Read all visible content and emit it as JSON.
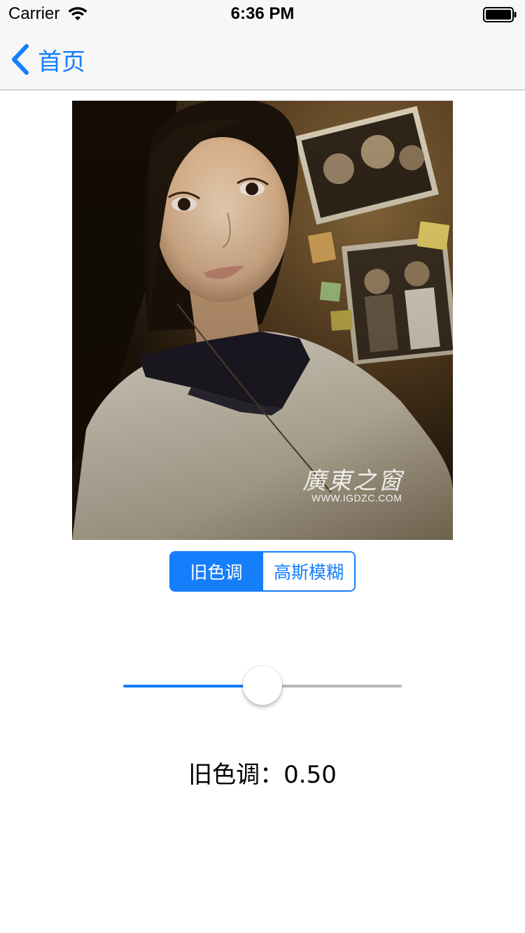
{
  "status_bar": {
    "carrier": "Carrier",
    "time": "6:36 PM",
    "wifi_icon": "wifi-icon",
    "battery_icon": "battery-icon"
  },
  "nav_bar": {
    "back_label": "首页",
    "back_icon": "chevron-left-icon"
  },
  "photo": {
    "watermark_text": "廣東之窗",
    "watermark_url": "WWW.IGDZC.COM"
  },
  "segmented_control": {
    "segments": [
      "旧色调",
      "高斯模糊"
    ],
    "selected_index": 0
  },
  "slider": {
    "value": 0.5,
    "min": 0,
    "max": 1
  },
  "value_label": "旧色调：0.50",
  "colors": {
    "accent": "#157efb",
    "nav_background": "#f7f7f7",
    "track_inactive": "#b7b7b7"
  }
}
